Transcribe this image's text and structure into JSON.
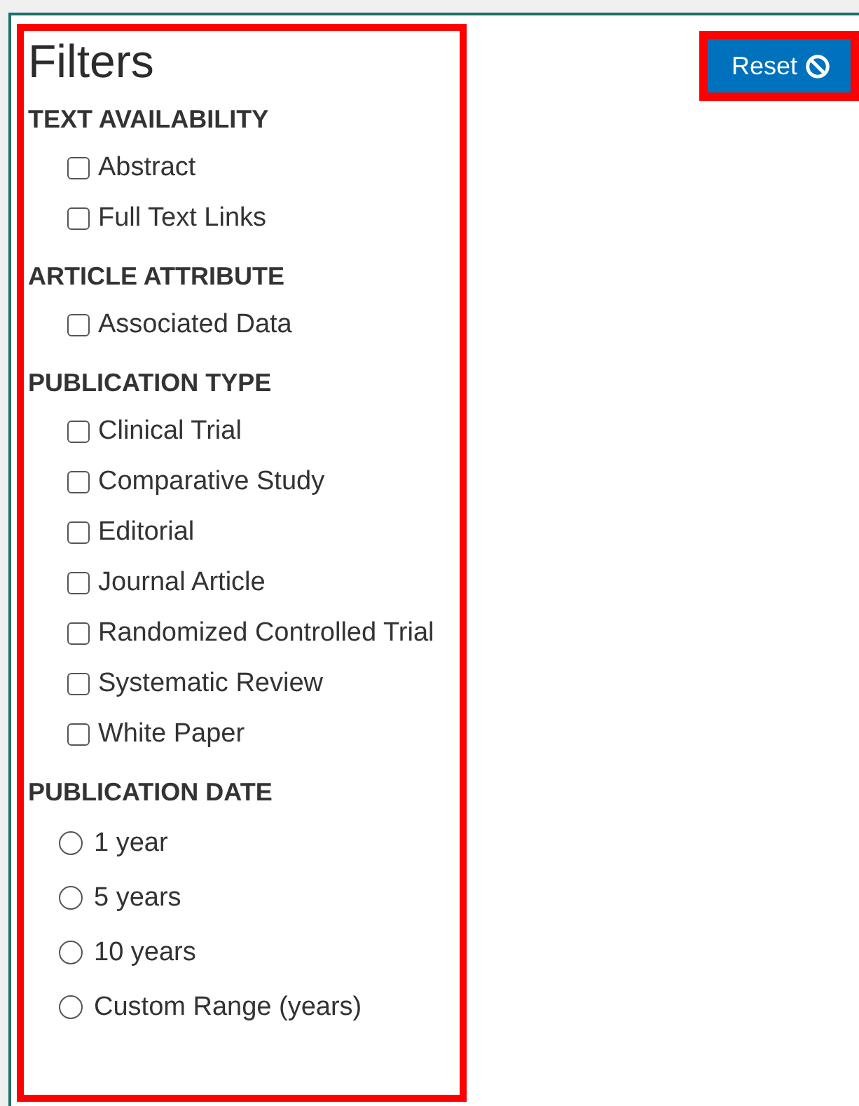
{
  "title": "Filters",
  "reset_button": {
    "label": "Reset"
  },
  "sections": [
    {
      "heading": "TEXT AVAILABILITY",
      "kind": "checkbox",
      "options": [
        {
          "label": "Abstract",
          "checked": false
        },
        {
          "label": "Full Text Links",
          "checked": false
        }
      ]
    },
    {
      "heading": "ARTICLE ATTRIBUTE",
      "kind": "checkbox",
      "options": [
        {
          "label": "Associated Data",
          "checked": false
        }
      ]
    },
    {
      "heading": "PUBLICATION TYPE",
      "kind": "checkbox",
      "options": [
        {
          "label": "Clinical Trial",
          "checked": false
        },
        {
          "label": "Comparative Study",
          "checked": false
        },
        {
          "label": "Editorial",
          "checked": false
        },
        {
          "label": "Journal Article",
          "checked": false
        },
        {
          "label": "Randomized Controlled Trial",
          "checked": false
        },
        {
          "label": "Systematic Review",
          "checked": false
        },
        {
          "label": "White Paper",
          "checked": false
        }
      ]
    },
    {
      "heading": "PUBLICATION DATE",
      "kind": "radio",
      "options": [
        {
          "label": "1 year",
          "selected": false
        },
        {
          "label": "5 years",
          "selected": false
        },
        {
          "label": "10 years",
          "selected": false
        },
        {
          "label": "Custom Range (years)",
          "selected": false
        }
      ]
    }
  ]
}
